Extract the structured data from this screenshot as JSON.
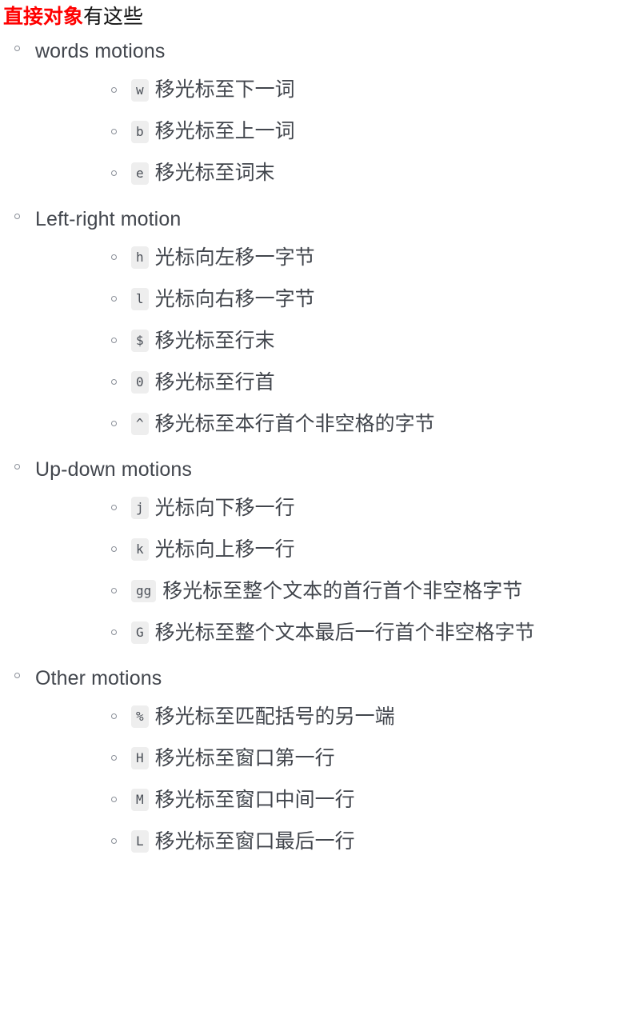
{
  "heading": {
    "highlight": "直接对象",
    "rest": "有这些",
    "highlight_color": "#ff0000",
    "rest_color": "#111111"
  },
  "style": {
    "bullet_glyph": "circle-outline",
    "code_background": "#eeeeee",
    "code_text_color": "#4a4f57",
    "body_text_color": "#42464d"
  },
  "sections": [
    {
      "label": "words motions",
      "items": [
        {
          "key": "w",
          "desc": "移光标至下一词"
        },
        {
          "key": "b",
          "desc": "移光标至上一词"
        },
        {
          "key": "e",
          "desc": "移光标至词末"
        }
      ]
    },
    {
      "label": "Left-right motion",
      "items": [
        {
          "key": "h",
          "desc": "光标向左移一字节"
        },
        {
          "key": "l",
          "desc": "光标向右移一字节"
        },
        {
          "key": "$",
          "desc": "移光标至行末"
        },
        {
          "key": "0",
          "desc": "移光标至行首"
        },
        {
          "key": "^",
          "desc": "移光标至本行首个非空格的字节"
        }
      ]
    },
    {
      "label": "Up-down motions",
      "items": [
        {
          "key": "j",
          "desc": "光标向下移一行"
        },
        {
          "key": "k",
          "desc": "光标向上移一行"
        },
        {
          "key": "gg",
          "desc": "移光标至整个文本的首行首个非空格字节"
        },
        {
          "key": "G",
          "desc": "移光标至整个文本最后一行首个非空格字节"
        }
      ]
    },
    {
      "label": "Other motions",
      "items": [
        {
          "key": "%",
          "desc": "移光标至匹配括号的另一端"
        },
        {
          "key": "H",
          "desc": "移光标至窗口第一行"
        },
        {
          "key": "M",
          "desc": "移光标至窗口中间一行"
        },
        {
          "key": "L",
          "desc": "移光标至窗口最后一行"
        }
      ]
    }
  ]
}
